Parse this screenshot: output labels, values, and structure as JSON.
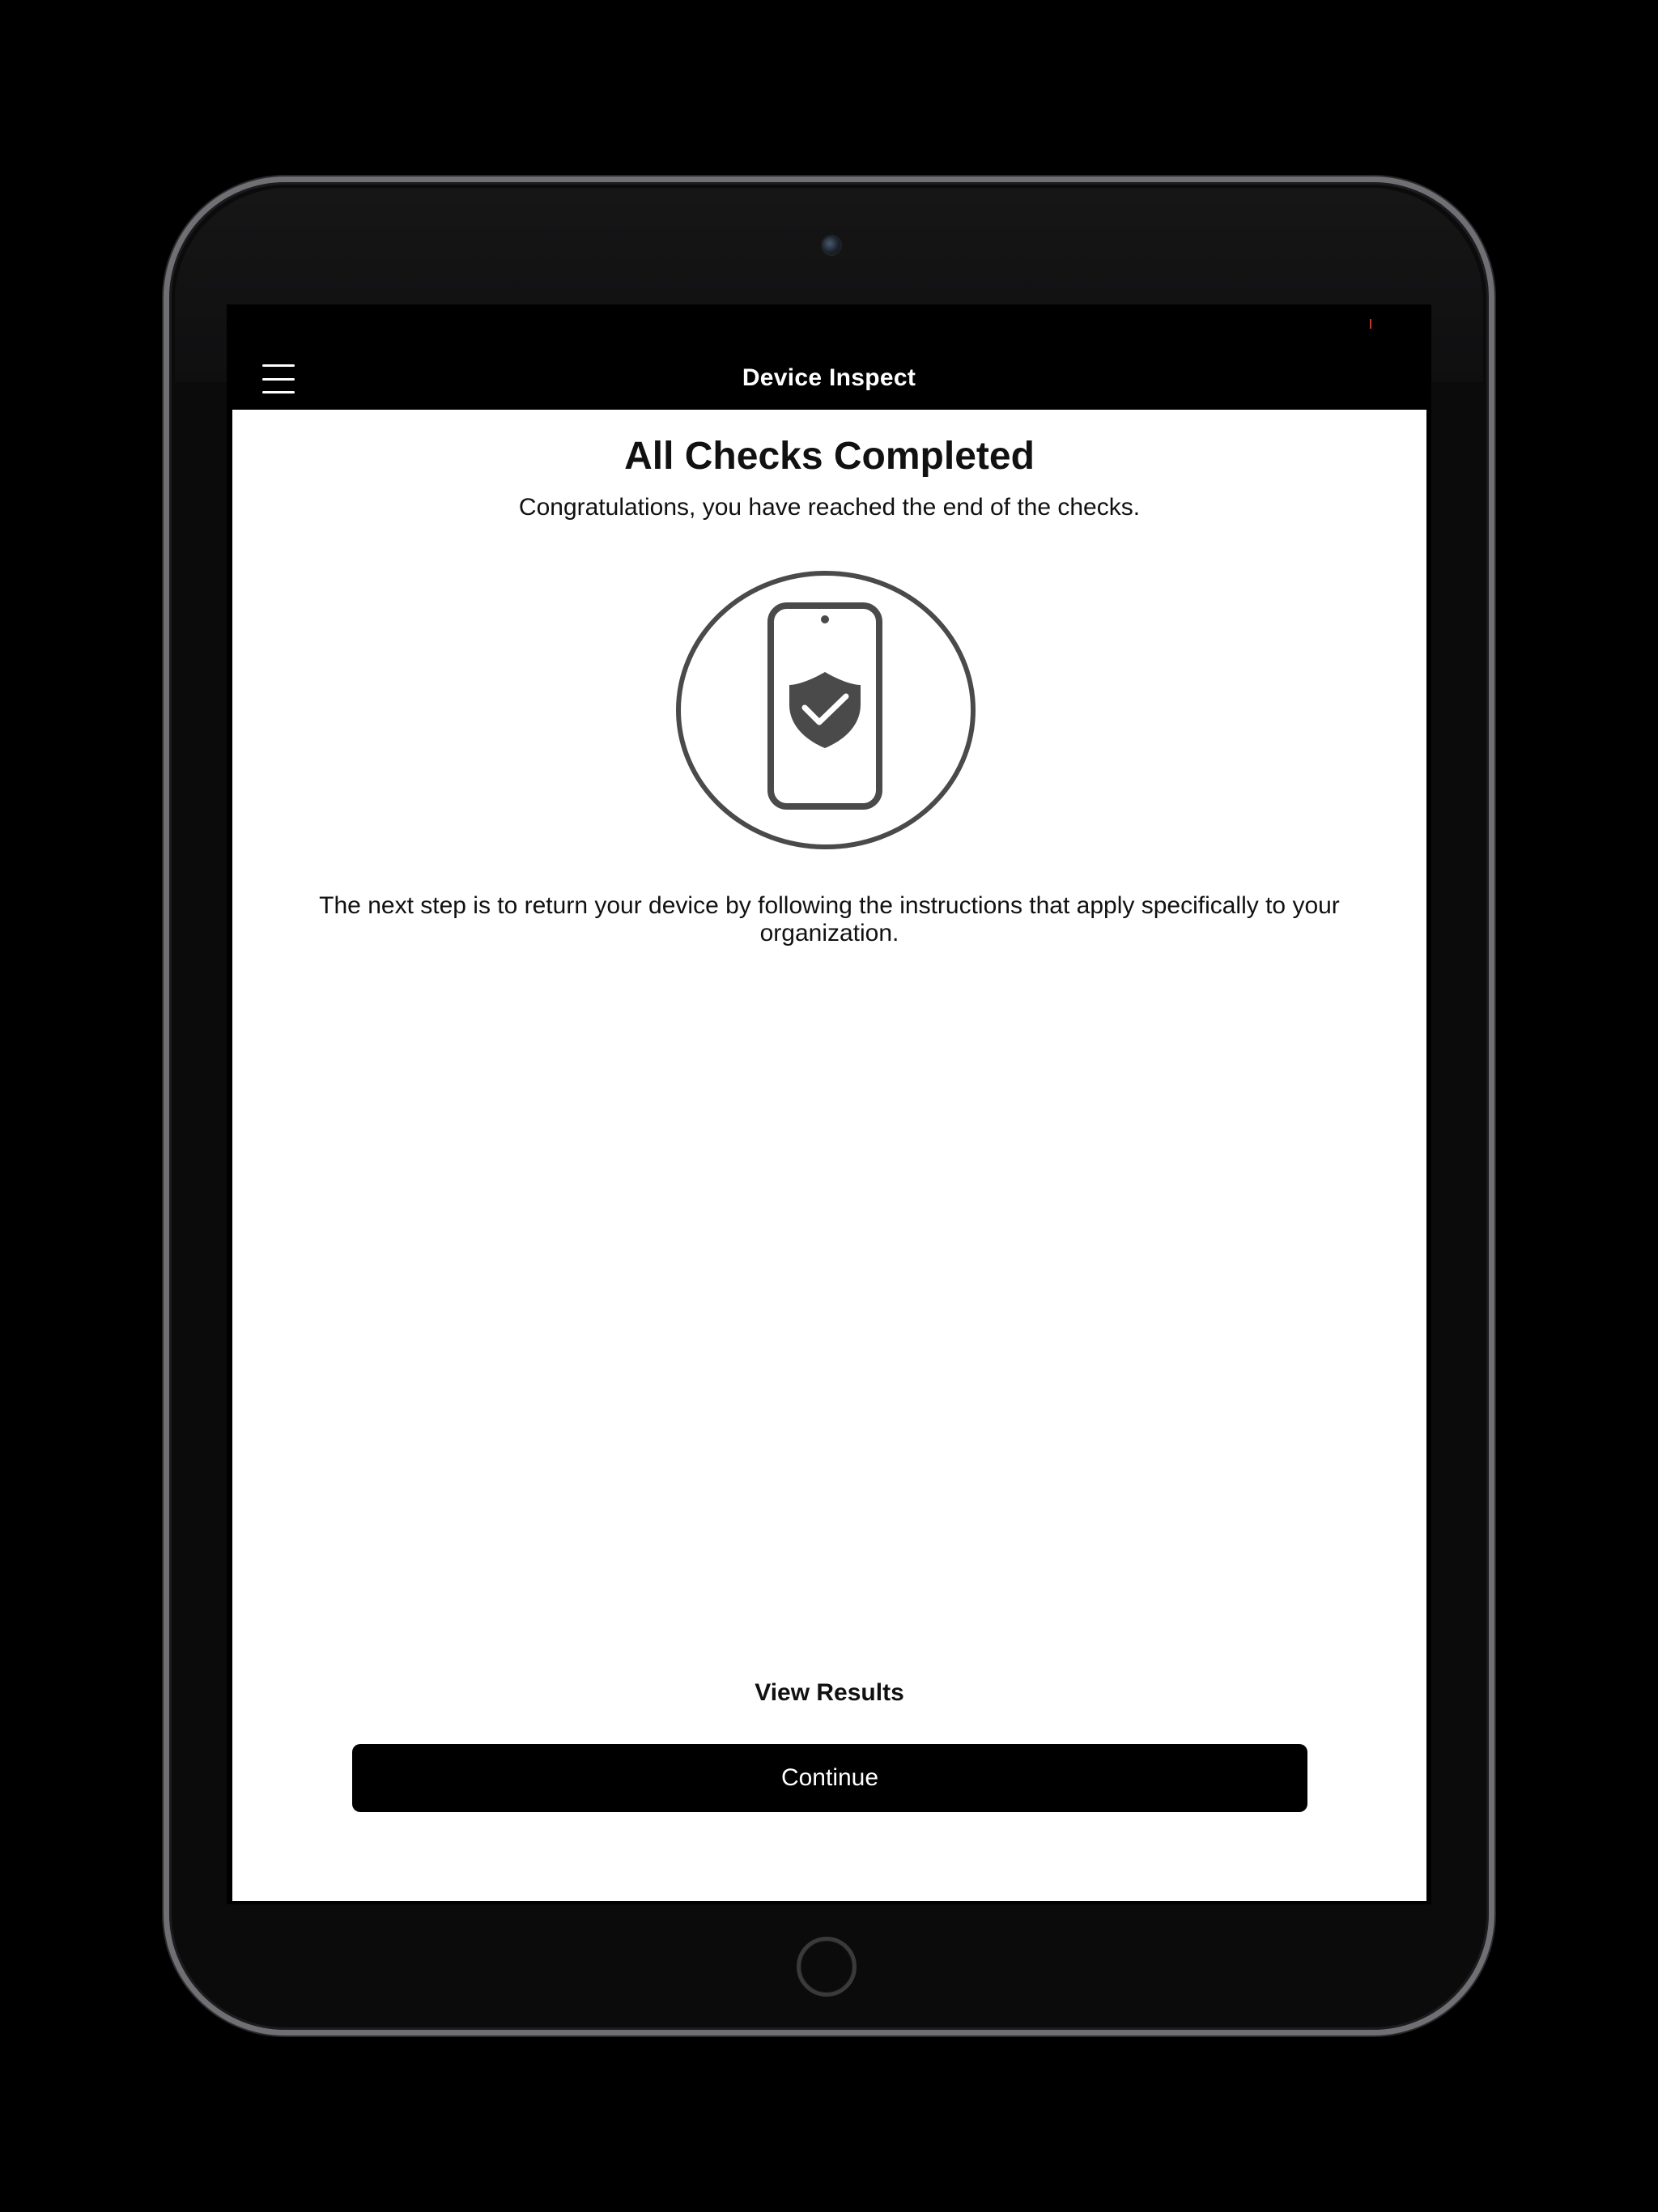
{
  "device": {
    "frame_color": "#6f6f74"
  },
  "nav": {
    "title": "Device Inspect",
    "menu_icon": "hamburger-menu-icon"
  },
  "content": {
    "title": "All Checks Completed",
    "subtitle": "Congratulations, you have reached the end of the checks.",
    "hero_icon": "phone-shield-check-icon",
    "instructions": "The next step is to return your device by following the instructions that apply specifically to your organization.",
    "view_results_label": "View Results",
    "continue_label": "Continue"
  },
  "colors": {
    "primary": "#000000",
    "background": "#ffffff",
    "icon": "#4a4a4a"
  }
}
